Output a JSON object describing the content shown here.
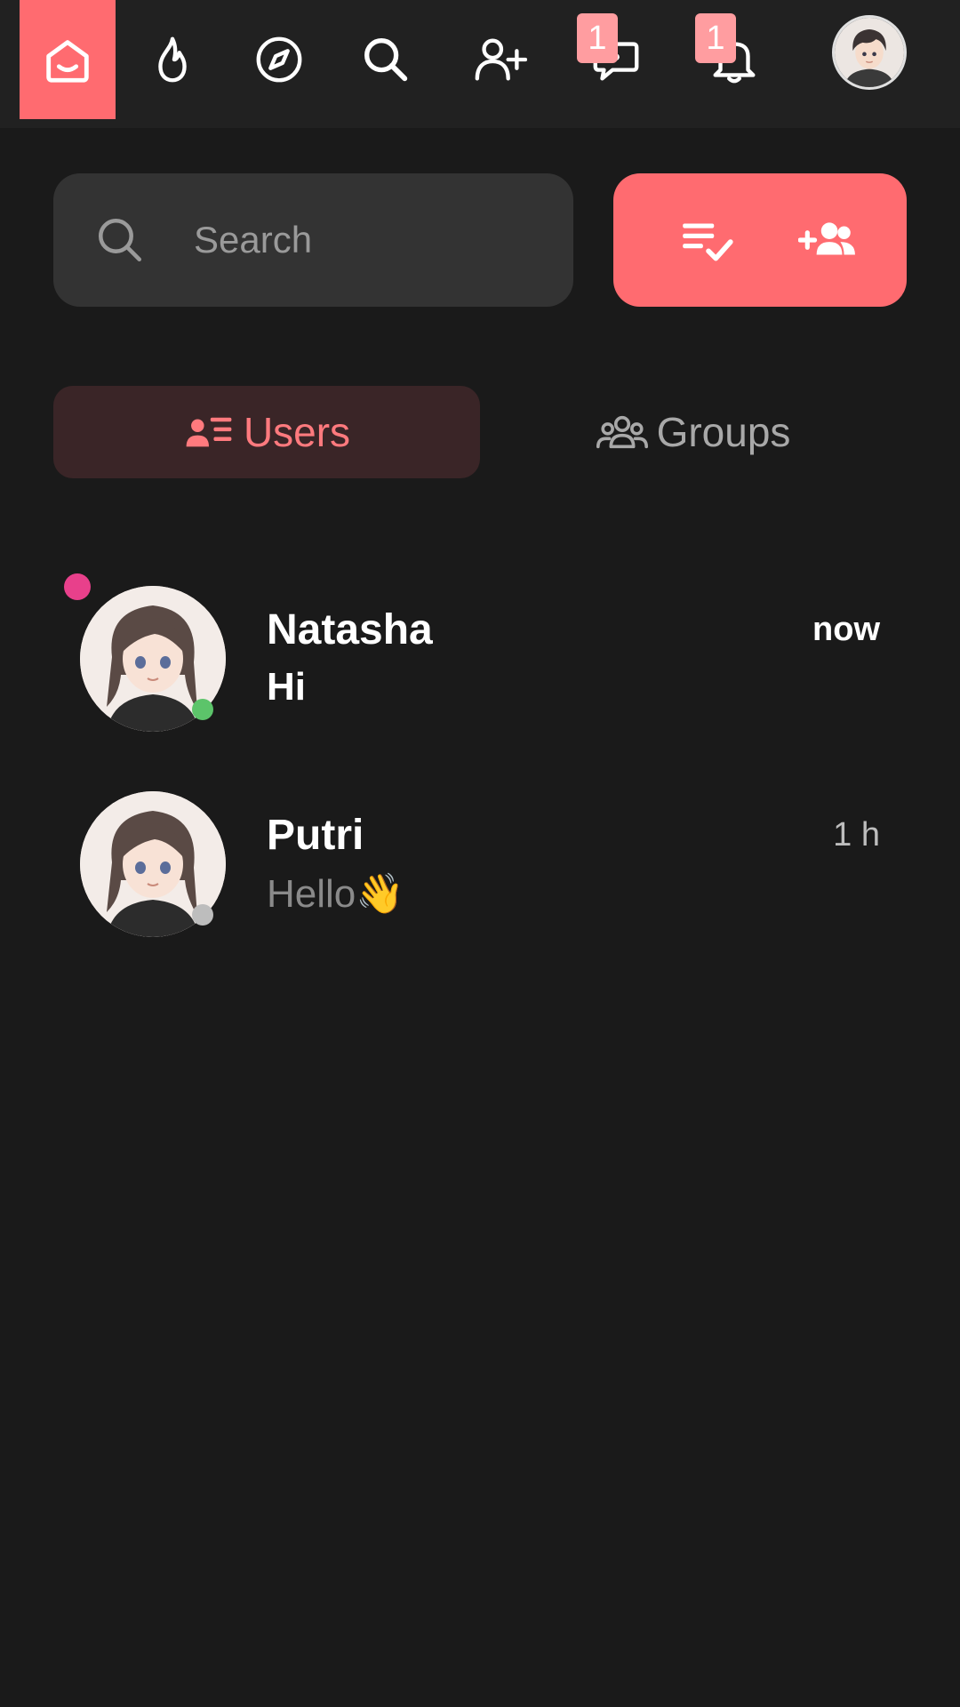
{
  "colors": {
    "accent": "#ff6b70",
    "badge": "#ff9da0",
    "background": "#1a1a1a",
    "online": "#5cc46a",
    "offline": "#bdbdbd",
    "unread": "#e8408b"
  },
  "nav": {
    "items": [
      {
        "icon": "home-icon",
        "active": true
      },
      {
        "icon": "fire-icon"
      },
      {
        "icon": "compass-icon"
      },
      {
        "icon": "search-icon"
      },
      {
        "icon": "add-user-icon"
      },
      {
        "icon": "chat-icon",
        "badge": "1"
      },
      {
        "icon": "bell-icon",
        "badge": "1"
      }
    ],
    "profile_icon": "avatar"
  },
  "search": {
    "placeholder": "Search"
  },
  "actions": {
    "icons": [
      "checklist-icon",
      "add-group-icon"
    ]
  },
  "tabs": [
    {
      "label": "Users",
      "icon": "user-list-icon",
      "active": true
    },
    {
      "label": "Groups",
      "icon": "groups-icon",
      "active": false
    }
  ],
  "chats": [
    {
      "name": "Natasha",
      "message": "Hi",
      "time": "now",
      "unread": true,
      "status": "online"
    },
    {
      "name": "Putri",
      "message": "Hello👋",
      "time": "1 h",
      "unread": false,
      "status": "offline"
    }
  ]
}
